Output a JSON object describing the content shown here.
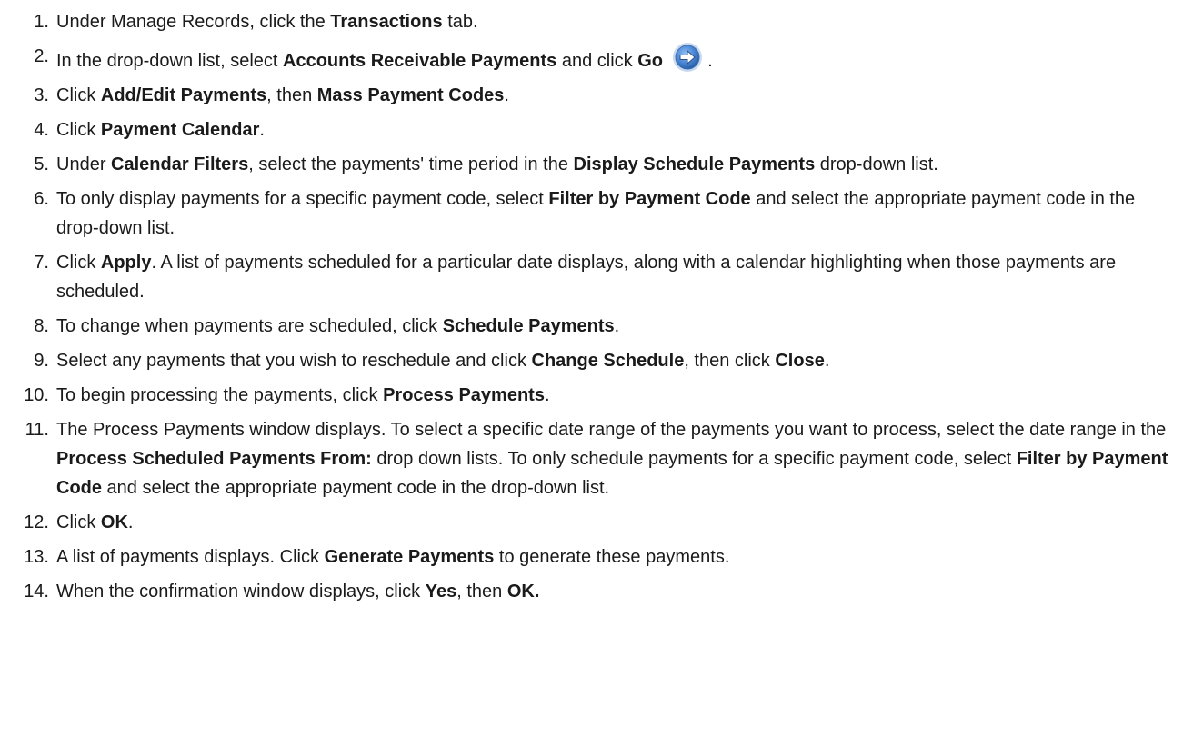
{
  "steps": [
    {
      "num": "1.",
      "parts": [
        {
          "t": "Under Manage Records, click the "
        },
        {
          "t": "Transactions",
          "b": true
        },
        {
          "t": " tab."
        }
      ]
    },
    {
      "num": "2.",
      "parts": [
        {
          "t": "In the drop-down list, select "
        },
        {
          "t": "Accounts Receivable Payments",
          "b": true
        },
        {
          "t": " and click "
        },
        {
          "t": "Go",
          "b": true
        },
        {
          "t": " "
        },
        {
          "icon": "go-arrow-icon"
        },
        {
          "t": " ."
        }
      ]
    },
    {
      "num": "3.",
      "parts": [
        {
          "t": "Click "
        },
        {
          "t": "Add/Edit Payments",
          "b": true
        },
        {
          "t": ", then "
        },
        {
          "t": "Mass Payment Codes",
          "b": true
        },
        {
          "t": "."
        }
      ]
    },
    {
      "num": "4.",
      "parts": [
        {
          "t": "Click "
        },
        {
          "t": "Payment Calendar",
          "b": true
        },
        {
          "t": "."
        }
      ]
    },
    {
      "num": "5.",
      "parts": [
        {
          "t": "Under "
        },
        {
          "t": "Calendar Filters",
          "b": true
        },
        {
          "t": ", select the payments' time period in the "
        },
        {
          "t": "Display Schedule Payments",
          "b": true
        },
        {
          "t": " drop-down list."
        }
      ]
    },
    {
      "num": "6.",
      "parts": [
        {
          "t": "To only display payments for a specific payment code, select "
        },
        {
          "t": "Filter by Payment Code",
          "b": true
        },
        {
          "t": " and select the appropriate payment code in the drop-down list."
        }
      ]
    },
    {
      "num": "7.",
      "parts": [
        {
          "t": "Click "
        },
        {
          "t": "Apply",
          "b": true
        },
        {
          "t": ". A list of payments scheduled for a particular date displays, along with a calendar highlighting when those payments are scheduled."
        }
      ]
    },
    {
      "num": "8.",
      "parts": [
        {
          "t": "To change when payments are scheduled, click "
        },
        {
          "t": "Schedule Payments",
          "b": true
        },
        {
          "t": "."
        }
      ]
    },
    {
      "num": "9.",
      "parts": [
        {
          "t": "Select any payments that you wish to reschedule and click "
        },
        {
          "t": "Change Schedule",
          "b": true
        },
        {
          "t": ", then click "
        },
        {
          "t": "Close",
          "b": true
        },
        {
          "t": "."
        }
      ]
    },
    {
      "num": "10.",
      "parts": [
        {
          "t": "To begin processing the payments, click "
        },
        {
          "t": "Process Payments",
          "b": true
        },
        {
          "t": "."
        }
      ]
    },
    {
      "num": "11.",
      "parts": [
        {
          "t": "The Process Payments window displays. To select a specific date range of the payments you want to process, select the date range in the "
        },
        {
          "t": "Process Scheduled Payments From:",
          "b": true
        },
        {
          "t": " drop down lists. To only schedule payments for a specific payment code, select "
        },
        {
          "t": "Filter by Payment Code",
          "b": true
        },
        {
          "t": " and select the appropriate payment code in the drop-down list."
        }
      ]
    },
    {
      "num": "12.",
      "parts": [
        {
          "t": "Click "
        },
        {
          "t": "OK",
          "b": true
        },
        {
          "t": "."
        }
      ]
    },
    {
      "num": "13.",
      "parts": [
        {
          "t": "A list of payments displays. Click "
        },
        {
          "t": "Generate Payments",
          "b": true
        },
        {
          "t": " to generate these payments."
        }
      ]
    },
    {
      "num": "14.",
      "parts": [
        {
          "t": "When the confirmation window displays, click "
        },
        {
          "t": "Yes",
          "b": true
        },
        {
          "t": ", then "
        },
        {
          "t": "OK.",
          "b": true
        }
      ]
    }
  ],
  "colors": {
    "text": "#1a1a1a",
    "icon_fill": "#4a86d4",
    "icon_ring": "#c9d9ee"
  }
}
